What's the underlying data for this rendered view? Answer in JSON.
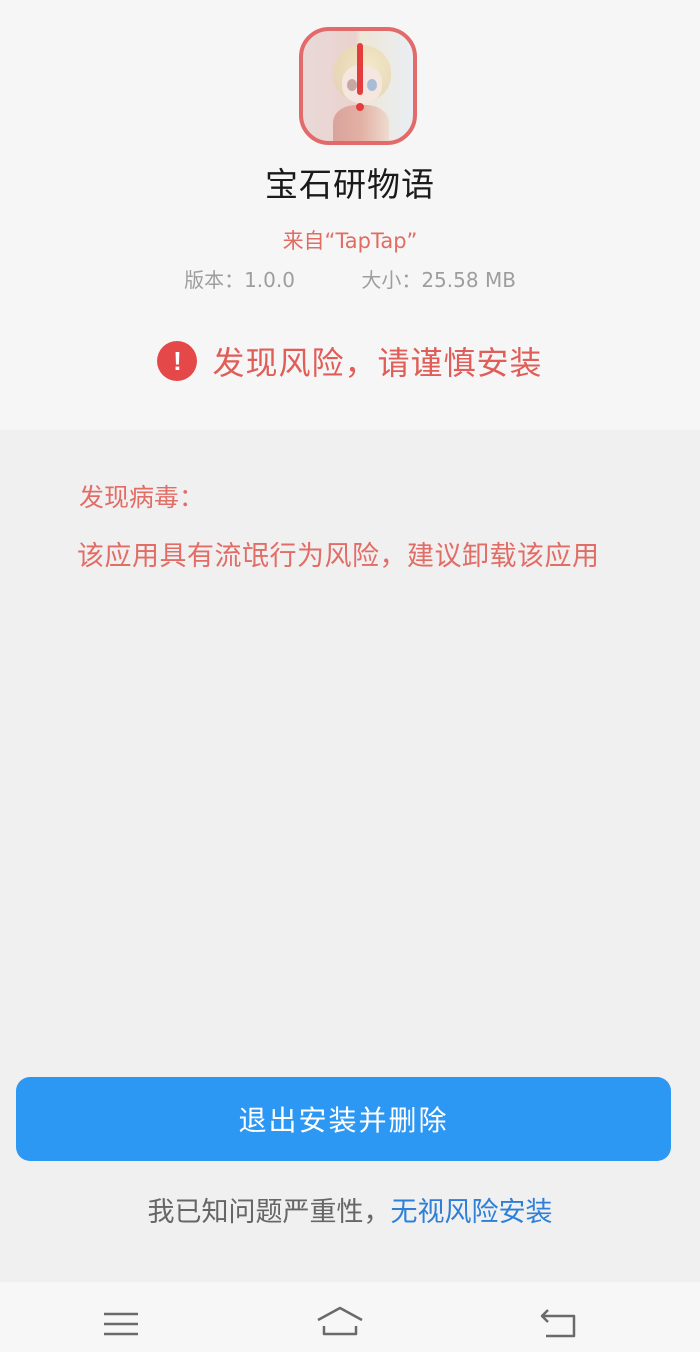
{
  "app": {
    "name": "宝石研物语",
    "source": "来自“TapTap”",
    "version": "版本：1.0.0",
    "size": "大小：25.58 MB",
    "icon": "app-icon-with-warning"
  },
  "risk": {
    "icon": "alert-circle-icon",
    "mark": "!",
    "text": "发现风险，请谨慎安装",
    "color": "#e54848"
  },
  "virus": {
    "title": "发现病毒：",
    "description": "该应用具有流氓行为风险，建议卸载该应用"
  },
  "actions": {
    "exit_delete_label": "退出安装并删除",
    "ignore_prefix": "我已知问题严重性，",
    "ignore_link": "无视风险安装",
    "primary_color": "#2d97f4",
    "link_color": "#2d7fd8"
  },
  "navbar": {
    "icons": [
      "menu-icon",
      "home-icon",
      "back-icon"
    ]
  }
}
